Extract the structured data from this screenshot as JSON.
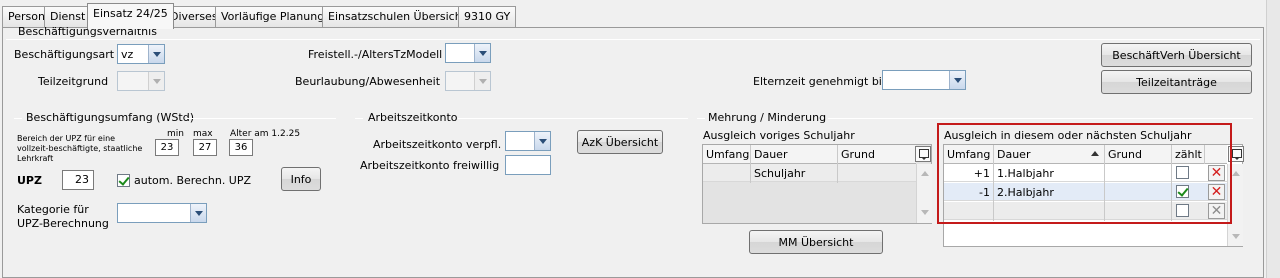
{
  "tabs": [
    "Person",
    "Dienst",
    "Einsatz 24/25",
    "Diverses",
    "Vorläufige Planung",
    "Einsatzschulen Übersicht",
    "9310 GY"
  ],
  "active_tab": "Einsatz 24/25",
  "beschaeftigung": {
    "section_title": "Beschäftigungsverhältnis",
    "art_label": "Beschäftigungsart",
    "art_value": "vz",
    "teilzeit_label": "Teilzeitgrund",
    "freistell_label": "Freistell.-/AltersTzModell",
    "beurlaubung_label": "Beurlaubung/Abwesenheit",
    "elternzeit_label": "Elternzeit genehmigt bis",
    "btn_beschverh": "BeschäftVerh Übersicht",
    "btn_teilzeit": "Teilzeitanträge"
  },
  "umfang": {
    "section_title": "Beschäftigungsumfang (WStd)",
    "desc": "Bereich der UPZ für eine vollzeit-beschäftigte, staatliche Lehrkraft",
    "min_label": "min",
    "max_label": "max",
    "alter_label": "Alter am 1.2.25",
    "min_value": "23",
    "max_value": "27",
    "alter_value": "36",
    "upz_label": "UPZ",
    "upz_value": "23",
    "autom_label": "autom. Berechn. UPZ",
    "info_btn": "Info",
    "kategorie_label": "Kategorie für UPZ-Berechnung"
  },
  "azk": {
    "section_title": "Arbeitszeitkonto",
    "verpfl_label": "Arbeitszeitkonto verpfl.",
    "freiwillig_label": "Arbeitszeitkonto freiwillig",
    "btn": "AzK Übersicht"
  },
  "mehrung": {
    "section_title": "Mehrung / Minderung",
    "prev_title": "Ausgleich voriges Schuljahr",
    "prev_headers": [
      "Umfang",
      "Dauer",
      "Grund"
    ],
    "prev_rows": [
      {
        "umfang": "",
        "dauer": "Schuljahr",
        "grund": ""
      }
    ],
    "cur_title": "Ausgleich in diesem oder nächsten Schuljahr",
    "cur_headers": [
      "Umfang",
      "Dauer",
      "Grund",
      "zählt"
    ],
    "cur_rows": [
      {
        "umfang": "+1",
        "dauer": "1.Halbjahr",
        "grund": "",
        "zaehlt": false
      },
      {
        "umfang": "-1",
        "dauer": "2.Halbjahr",
        "grund": "",
        "zaehlt": true
      },
      {
        "umfang": "",
        "dauer": "",
        "grund": "",
        "zaehlt": false
      }
    ],
    "mm_btn": "MM Übersicht"
  },
  "colors": {
    "highlight": "#c41a1a",
    "row_selected": "#e3ebf7"
  },
  "icons": [
    "combo-arrow-icon",
    "delete-icon",
    "grid-menu-icon"
  ]
}
